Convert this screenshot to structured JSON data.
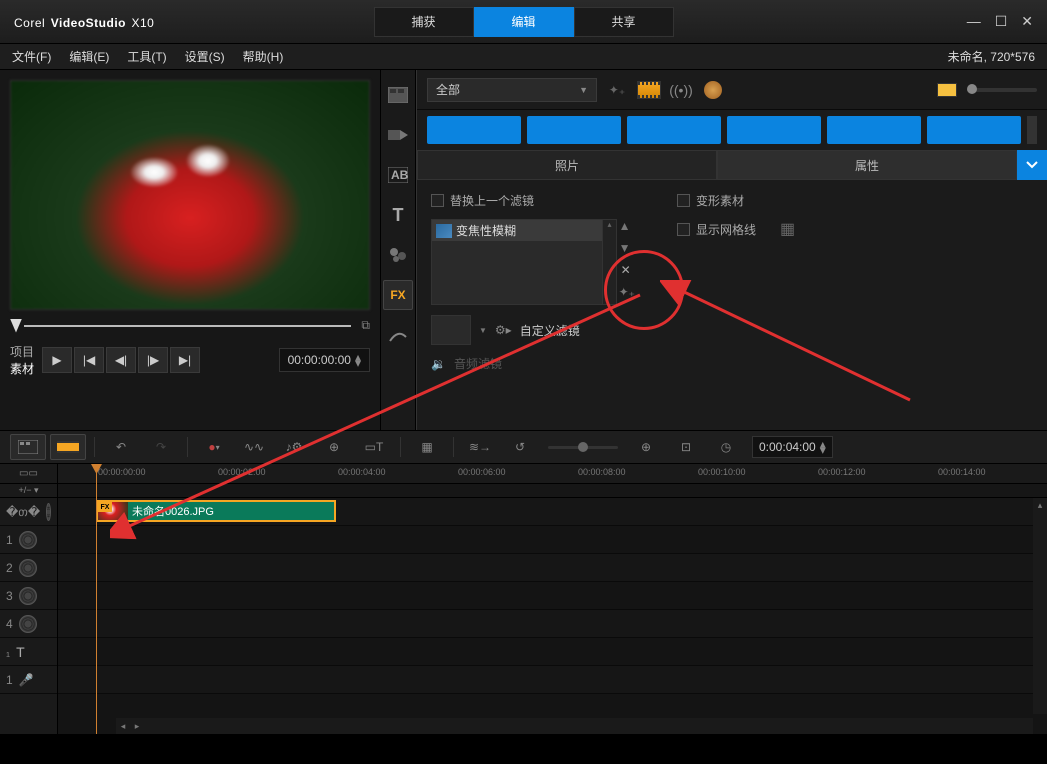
{
  "app": {
    "logo_prefix": "Corel",
    "logo_mid": "VideoStudio",
    "logo_suffix": "X10"
  },
  "main_tabs": [
    "捕获",
    "编辑",
    "共享"
  ],
  "main_tab_active": 1,
  "menu": {
    "items": [
      "文件(F)",
      "编辑(E)",
      "工具(T)",
      "设置(S)",
      "帮助(H)"
    ],
    "right_info": "未命名, 720*576"
  },
  "preview": {
    "mode_labels": [
      "项目",
      "素材"
    ],
    "timecode": "00:00:00:00"
  },
  "lib_sidebar": {
    "icons": [
      "media-icon",
      "transition-icon",
      "title-ab-icon",
      "text-t-icon",
      "graphic-icon",
      "fx-icon",
      "path-icon"
    ],
    "active": 5,
    "fx_label": "FX"
  },
  "options": {
    "dropdown": "全部",
    "tabs": [
      "照片",
      "属性"
    ],
    "tab_active": 1,
    "replace_last_filter": "替换上一个滤镜",
    "filter_name": "变焦性模糊",
    "deform_material": "变形素材",
    "show_grid": "显示网格线",
    "custom_filter": "自定义滤镜",
    "audio_filter": "音频滤镜"
  },
  "tl_toolbar": {
    "timecode": "0:00:04:00"
  },
  "ruler": {
    "ticks": [
      "00:00:00:00",
      "00:00:02:00",
      "00:00:04:00",
      "00:00:06:00",
      "00:00:08:00",
      "00:00:10:00",
      "00:00:12:00",
      "00:00:14:00"
    ]
  },
  "tracks": {
    "sub_controls": "+/− ▾",
    "labels": [
      "",
      "1",
      "2",
      "3",
      "4",
      "",
      "1"
    ],
    "clip_fx": "FX",
    "clip_name": "未命名0026.JPG"
  }
}
